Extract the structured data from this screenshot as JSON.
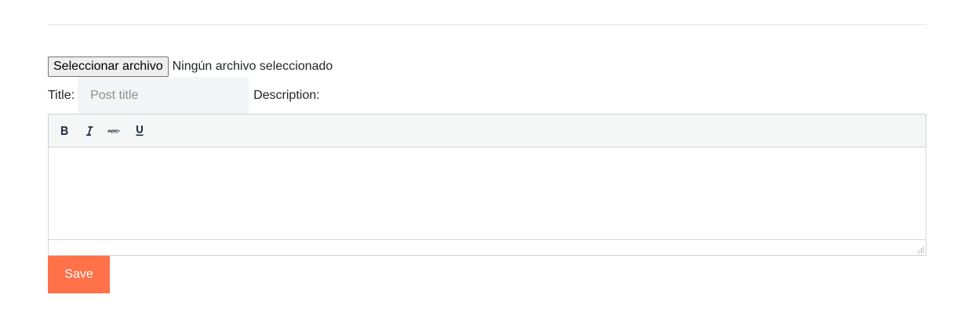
{
  "file_upload": {
    "button_label": "Seleccionar archivo",
    "status_text": "Ningún archivo seleccionado"
  },
  "form": {
    "title_label": "Title:",
    "title_placeholder": "Post title",
    "title_value": "",
    "description_label": "Description:"
  },
  "editor": {
    "toolbar": [
      {
        "name": "bold-icon",
        "label": "Bold"
      },
      {
        "name": "italic-icon",
        "label": "Italic"
      },
      {
        "name": "strikethrough-icon",
        "label": "Strikethrough"
      },
      {
        "name": "underline-icon",
        "label": "Underline"
      }
    ],
    "content": ""
  },
  "actions": {
    "save_label": "Save"
  },
  "colors": {
    "accent": "#ff7148",
    "input_bg": "#f4f5f6",
    "toolbar_bg": "#f5f6f6",
    "border": "#d1d5d8",
    "icon": "#222f3e"
  }
}
